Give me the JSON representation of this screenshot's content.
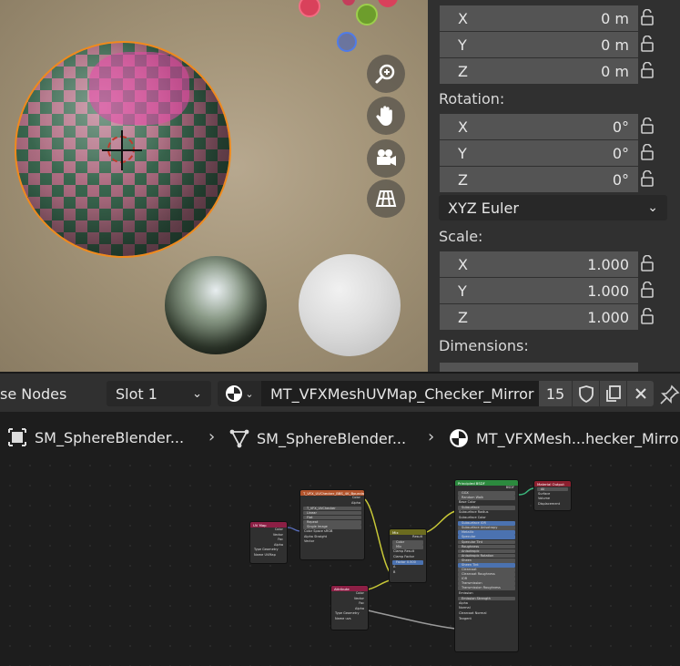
{
  "properties": {
    "location": [
      {
        "axis": "X",
        "value": "0 m"
      },
      {
        "axis": "Y",
        "value": "0 m"
      },
      {
        "axis": "Z",
        "value": "0 m"
      }
    ],
    "rotation_label": "Rotation:",
    "rotation": [
      {
        "axis": "X",
        "value": "0°"
      },
      {
        "axis": "Y",
        "value": "0°"
      },
      {
        "axis": "Z",
        "value": "0°"
      }
    ],
    "rotation_mode": "XYZ Euler",
    "scale_label": "Scale:",
    "scale": [
      {
        "axis": "X",
        "value": "1.000"
      },
      {
        "axis": "Y",
        "value": "1.000"
      },
      {
        "axis": "Z",
        "value": "1.000"
      }
    ],
    "dimensions_label": "Dimensions:"
  },
  "node_header": {
    "editor_name": "se Nodes",
    "slot": "Slot 1",
    "material_name": "MT_VFXMeshUVMap_Checker_Mirror",
    "user_count": "15"
  },
  "breadcrumb": [
    {
      "label": "SM_SphereBlender...",
      "icon": "object-icon"
    },
    {
      "label": "SM_SphereBlender...",
      "icon": "mesh-icon"
    },
    {
      "label": "MT_VFXMesh...hecker_Mirro",
      "icon": "material-icon"
    }
  ],
  "nodes": {
    "image_texture": {
      "title": "T_VFX_UVChecker_BBS_4K_BoundaryEdge",
      "outputs": [
        "Color",
        "Alpha"
      ],
      "fields": [
        "T_VFX_UVChecker",
        "Linear",
        "Flat",
        "Repeat",
        "Single Image",
        "Color Space",
        "sRGB",
        "Alpha",
        "Straight",
        "Vector"
      ],
      "color": "#b2532b"
    },
    "uv_map_1": {
      "title": "UV Map",
      "outputs": [
        "Color",
        "Vector",
        "Fac",
        "Alpha"
      ],
      "fields": [
        "Type",
        "Geometry",
        "Name",
        "UVMap"
      ],
      "color": "#8c1f45"
    },
    "uv_map_2": {
      "title": "Attribute",
      "outputs": [
        "Color",
        "Vector",
        "Fac",
        "Alpha"
      ],
      "fields": [
        "Type",
        "Geometry",
        "Name",
        "uvs"
      ],
      "color": "#8c1f45"
    },
    "mix": {
      "title": "Mix",
      "outputs": [
        "Result"
      ],
      "fields": [
        "Color",
        "Mix",
        "Clamp Result",
        "Clamp Factor",
        "Factor",
        "0.500",
        "A",
        "B"
      ],
      "color": "#6b6b1f"
    },
    "bsdf": {
      "title": "Principled BSDF",
      "outputs": [
        "BSDF"
      ],
      "fields": [
        "GGX",
        "Random Walk",
        "Base Color",
        "Subsurface",
        "Subsurface Radius",
        "Subsurface Color",
        "Subsurface IOR",
        "Subsurface Anisotropy",
        "Metallic",
        "Specular",
        "Specular Tint",
        "Roughness",
        "Anisotropic",
        "Anisotropic Rotation",
        "Sheen",
        "Sheen Tint",
        "Clearcoat",
        "Clearcoat Roughness",
        "IOR",
        "Transmission",
        "Transmission Roughness",
        "Emission",
        "Emission Strength",
        "Alpha",
        "Normal",
        "Clearcoat Normal",
        "Tangent"
      ],
      "color": "#2c8a3e"
    },
    "output": {
      "title": "Material Output",
      "outputs": [],
      "fields": [
        "All",
        "Surface",
        "Volume",
        "Displacement"
      ],
      "color": "#8c1f2f"
    }
  },
  "colors": {
    "selection_outline": "#f08a1c",
    "panel_bg": "#303030",
    "field_bg": "#545454"
  }
}
